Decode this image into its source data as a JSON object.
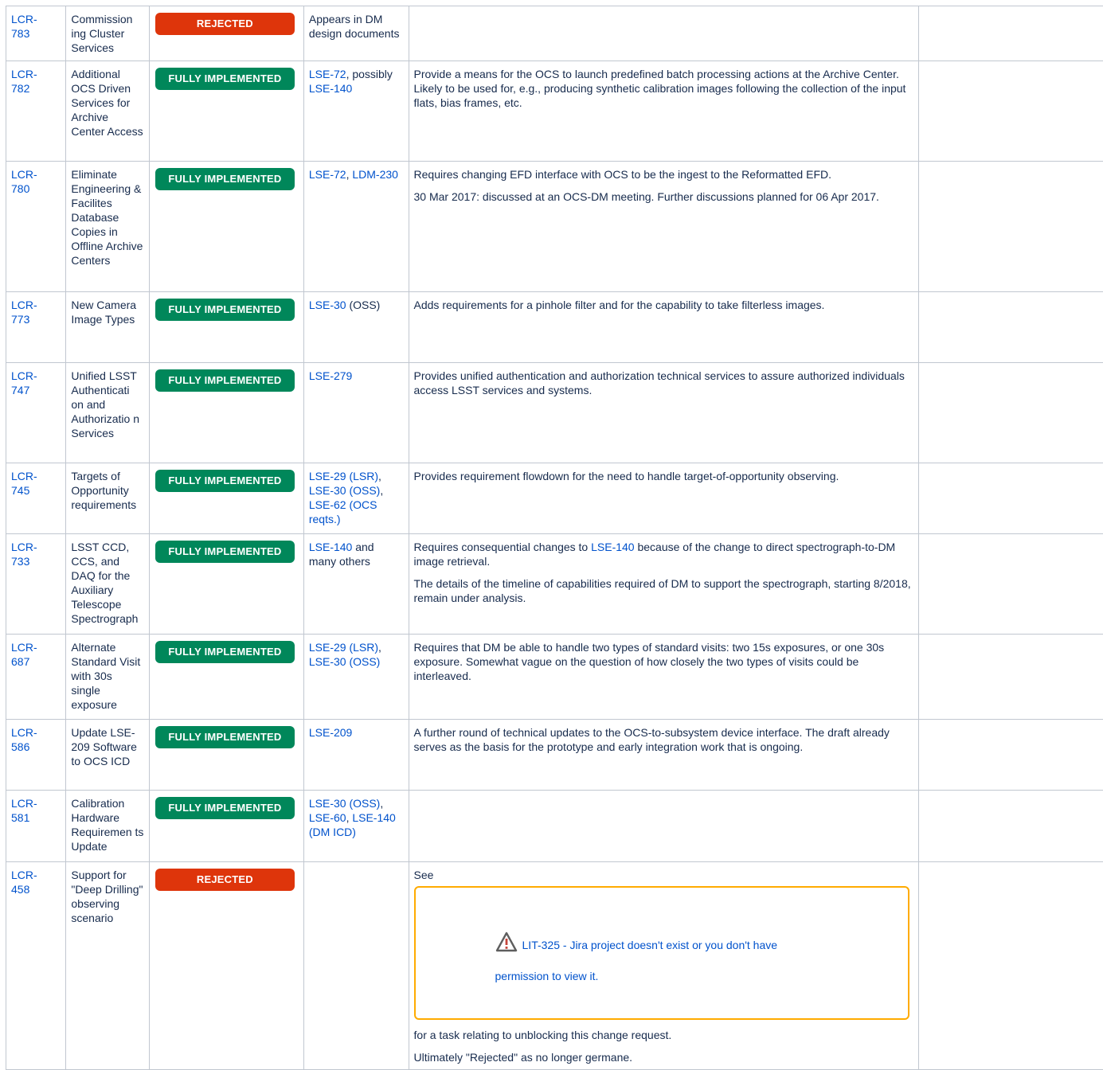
{
  "rows": [
    {
      "id": "LCR-\n783",
      "title": "Commission ing Cluster Services",
      "status": "REJECTED",
      "status_color": "red",
      "docs": [
        {
          "text": "Appears in DM design documents",
          "link": false
        }
      ],
      "desc": []
    },
    {
      "id": "LCR-\n782",
      "title": "Additional OCS Driven Services for Archive Center Access",
      "status": "FULLY IMPLEMENTED",
      "status_color": "green",
      "docs": [
        {
          "text": "LSE-72",
          "link": true
        },
        {
          "text": ", possibly ",
          "link": false
        },
        {
          "text": "LSE-140",
          "link": true
        }
      ],
      "desc": [
        "Provide a means for the OCS to launch predefined batch processing actions at the Archive Center. Likely to be used for, e.g., producing synthetic calibration images following the collection of the input flats, bias frames, etc."
      ]
    },
    {
      "id": "LCR-\n780",
      "title": "Eliminate Engineering & Facilites Database Copies in Offline Archive Centers",
      "status": "FULLY IMPLEMENTED",
      "status_color": "green",
      "docs": [
        {
          "text": "LSE-72",
          "link": true
        },
        {
          "text": ", ",
          "link": false
        },
        {
          "text": "LDM-230",
          "link": true
        }
      ],
      "desc": [
        "Requires changing EFD interface with OCS to be the ingest to the Reformatted EFD.",
        "30 Mar 2017: discussed at an OCS-DM meeting. Further discussions planned for 06 Apr 2017."
      ]
    },
    {
      "id": "LCR-\n773",
      "title": "New Camera Image Types",
      "status": "FULLY IMPLEMENTED",
      "status_color": "green",
      "docs": [
        {
          "text": "LSE-30",
          "link": true
        },
        {
          "text": " (OSS)",
          "link": false
        }
      ],
      "desc": [
        "Adds requirements for a pinhole filter and for the capability to take filterless images."
      ]
    },
    {
      "id": "LCR-\n747",
      "title": "Unified LSST Authenticati on and Authorizatio n Services",
      "status": "FULLY IMPLEMENTED",
      "status_color": "green",
      "docs": [
        {
          "text": "LSE-279",
          "link": true
        }
      ],
      "desc": [
        "Provides unified authentication and authorization technical services to assure authorized individuals access LSST services and systems."
      ]
    },
    {
      "id": "LCR-\n745",
      "title": "Targets of Opportunity requirements",
      "status": "FULLY IMPLEMENTED",
      "status_color": "green",
      "docs": [
        {
          "text": "LSE-29 (LSR)",
          "link": true
        },
        {
          "text": ", ",
          "link": false
        },
        {
          "text": "LSE-30 (OSS)",
          "link": true
        },
        {
          "text": ", ",
          "link": false
        },
        {
          "text": "LSE-62 (OCS reqts.)",
          "link": true
        }
      ],
      "desc": [
        "Provides requirement flowdown for the need to handle target-of-opportunity observing."
      ]
    },
    {
      "id": "LCR-\n733",
      "title": "LSST CCD, CCS, and DAQ for the Auxiliary Telescope Spectrograph",
      "status": "FULLY IMPLEMENTED",
      "status_color": "green",
      "docs": [
        {
          "text": "LSE-140",
          "link": true
        },
        {
          "text": " and many others",
          "link": false
        }
      ],
      "desc": [
        "Requires consequential changes to ",
        "because of the change to direct spectrograph-to-DM image retrieval.",
        "The details of the timeline of capabilities required of DM to support the spectrograph, starting 8/2018, remain under analysis."
      ],
      "desc_link": "LSE-140"
    },
    {
      "id": "LCR-\n687",
      "title": "Alternate Standard Visit with 30s single exposure",
      "status": "FULLY IMPLEMENTED",
      "status_color": "green",
      "docs": [
        {
          "text": "LSE-29 (LSR)",
          "link": true
        },
        {
          "text": ", ",
          "link": false
        },
        {
          "text": "LSE-30 (OSS)",
          "link": true
        }
      ],
      "desc": [
        "Requires that DM be able to handle two types of standard visits: two 15s exposures, or one 30s exposure. Somewhat vague on the question of how closely the two types of visits could be interleaved."
      ]
    },
    {
      "id": "LCR-\n586",
      "title": "Update LSE-209 Software to OCS ICD",
      "status": "FULLY IMPLEMENTED",
      "status_color": "green",
      "docs": [
        {
          "text": "LSE-209",
          "link": true
        }
      ],
      "desc": [
        "A further round of technical updates to the OCS-to-subsystem device interface. The draft already serves as the basis for the prototype and early integration work that is ongoing."
      ]
    },
    {
      "id": "LCR-\n581",
      "title": "Calibration Hardware Requiremen ts Update",
      "status": "FULLY IMPLEMENTED",
      "status_color": "green",
      "docs": [
        {
          "text": "LSE-30 (OSS)",
          "link": true
        },
        {
          "text": ", ",
          "link": false
        },
        {
          "text": "LSE-60",
          "link": true
        },
        {
          "text": ", ",
          "link": false
        },
        {
          "text": "LSE-140 (DM ICD)",
          "link": true
        }
      ],
      "desc": []
    },
    {
      "id": "LCR-\n458",
      "title": "Support for \"Deep Drilling\" observing scenario",
      "status": "REJECTED",
      "status_color": "red",
      "docs": [],
      "desc": []
    }
  ],
  "row458": {
    "see": "See",
    "jira_link": "LIT-325",
    "jira_msg": " - Jira project doesn't exist or you don't have",
    "jira_msg2": "permission to view it.",
    "after": "for a task relating to unblocking this change request.",
    "final": "Ultimately \"Rejected\" as no longer germane."
  },
  "icons": {
    "warning": "warning-triangle-icon"
  },
  "colors": {
    "green": "#00875a",
    "red": "#de350b",
    "link": "#0052cc",
    "warning_border": "#ffab00"
  }
}
